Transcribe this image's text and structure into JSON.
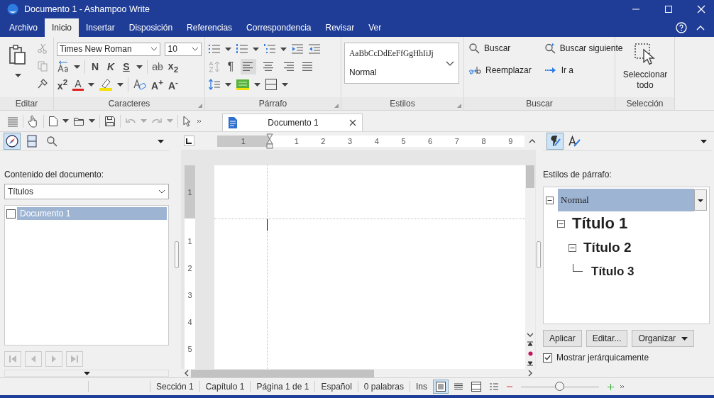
{
  "window": {
    "title": "Documento 1 - Ashampoo Write"
  },
  "menu": [
    {
      "label": "Archivo",
      "selected": false
    },
    {
      "label": "Inicio",
      "selected": true
    },
    {
      "label": "Insertar",
      "selected": false
    },
    {
      "label": "Disposición",
      "selected": false
    },
    {
      "label": "Referencias",
      "selected": false
    },
    {
      "label": "Correspondencia",
      "selected": false
    },
    {
      "label": "Revisar",
      "selected": false
    },
    {
      "label": "Ver",
      "selected": false
    }
  ],
  "ribbon": {
    "editar": {
      "label": "Editar"
    },
    "caracteres": {
      "label": "Caracteres",
      "font": "Times New Roman",
      "size": "10",
      "format_row_1": [
        {
          "text": "N",
          "kind": "bold"
        },
        {
          "text": "K",
          "kind": "italic"
        },
        {
          "text": "S",
          "kind": "underline"
        },
        {
          "text": "ab",
          "kind": "strike"
        },
        {
          "text": "x$_{2}$",
          "kind": "sub"
        }
      ],
      "format_row_2": [
        {
          "text": "x$^{2}$",
          "kind": "sup"
        },
        {
          "text": "A",
          "kind": "fontcolor"
        },
        {
          "text": "A$^{+}$",
          "kind": "grow"
        },
        {
          "text": "A$^{-}$",
          "kind": "shrink"
        }
      ]
    },
    "parrafo": {
      "label": "Párrafo",
      "pilcrow": "¶",
      "align": [
        {
          "kind": "left",
          "selected": true
        },
        {
          "kind": "center",
          "selected": false
        },
        {
          "kind": "right",
          "selected": false
        },
        {
          "kind": "justify",
          "selected": false
        }
      ]
    },
    "estilos": {
      "label": "Estilos",
      "preview": "AaBbCcDdEeFfGgHhIiJj",
      "current": "Normal"
    },
    "buscar": {
      "label": "Buscar",
      "commands": [
        "Buscar",
        "Buscar siguiente",
        "Reemplazar",
        "Ir a"
      ]
    },
    "seleccion": {
      "label": "Selección",
      "command": "Seleccionar todo"
    }
  },
  "document_tab": {
    "title": "Documento 1"
  },
  "left_panel": {
    "nav_tabs": [
      {
        "kind": "navigator",
        "selected": true
      },
      {
        "kind": "pages",
        "selected": false
      },
      {
        "kind": "search",
        "selected": false
      }
    ],
    "heading": "Contenido del documento:",
    "filter": "Títulos",
    "tree": [
      {
        "label": "Documento 1",
        "checked": false,
        "selected": true
      }
    ]
  },
  "document": {
    "hruler": [
      "1",
      "1",
      "2",
      "3",
      "4",
      "5",
      "6",
      "7",
      "8",
      "9"
    ],
    "vruler": [
      "1",
      "1",
      "2",
      "3",
      "4",
      "5"
    ]
  },
  "right_panel": {
    "tabs": [
      {
        "kind": "paragraph",
        "selected": true
      },
      {
        "kind": "character",
        "selected": false
      }
    ],
    "heading": "Estilos de párrafo:",
    "styles": [
      {
        "label": "Normal",
        "selected": true,
        "expanded": true,
        "children": [
          {
            "label": "Título 1",
            "selected": false,
            "expanded": true,
            "children": [
              {
                "label": "Título 2",
                "selected": false,
                "expanded": true,
                "children": [
                  {
                    "label": "Título 3",
                    "selected": false
                  }
                ]
              }
            ]
          }
        ]
      }
    ],
    "buttons": [
      "Aplicar",
      "Editar...",
      "Organizar"
    ],
    "hierarchical": {
      "label": "Mostrar jerárquicamente",
      "checked": true
    }
  },
  "status_bar": {
    "fields": [
      "Sección 1",
      "Capítulo 1",
      "Página 1 de 1",
      "Español",
      "0 palabras",
      "Ins"
    ],
    "views": [
      {
        "kind": "print",
        "selected": true
      },
      {
        "kind": "normal",
        "selected": false
      },
      {
        "kind": "page",
        "selected": false
      },
      {
        "kind": "outline",
        "selected": false
      }
    ],
    "zoom": {
      "level": 0.5
    }
  }
}
